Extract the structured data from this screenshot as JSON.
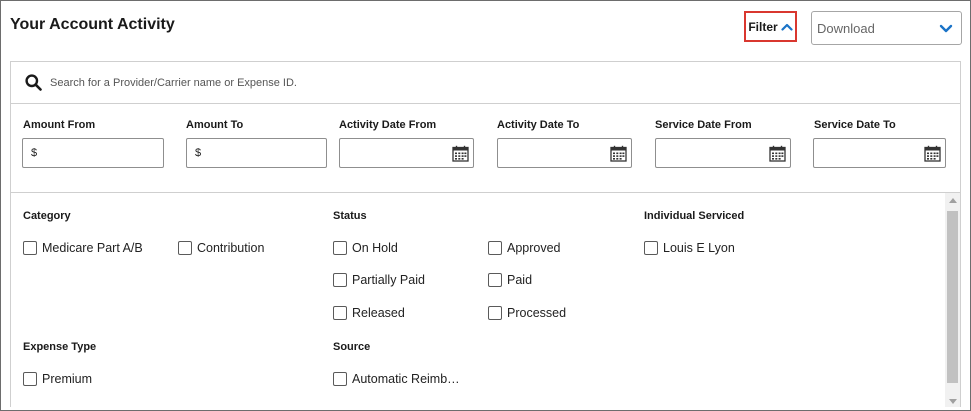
{
  "header": {
    "title": "Your Account Activity",
    "filter_label": "Filter",
    "download_label": "Download"
  },
  "search": {
    "placeholder": "Search for a Provider/Carrier name or Expense ID.",
    "value": ""
  },
  "fields": [
    {
      "label": "Amount From",
      "prefix": "$",
      "icon": ""
    },
    {
      "label": "Amount To",
      "prefix": "$",
      "icon": ""
    },
    {
      "label": "Activity Date From",
      "prefix": "",
      "icon": "calendar-icon"
    },
    {
      "label": "Activity Date To",
      "prefix": "",
      "icon": "calendar-icon"
    },
    {
      "label": "Service Date From",
      "prefix": "",
      "icon": "calendar-icon"
    },
    {
      "label": "Service Date To",
      "prefix": "",
      "icon": "calendar-icon"
    }
  ],
  "groups": {
    "category": {
      "label": "Category",
      "options": [
        "Medicare Part A/B",
        "Contribution"
      ]
    },
    "status": {
      "label": "Status",
      "options": [
        "On Hold",
        "Approved",
        "Partially Paid",
        "Paid",
        "Released",
        "Processed"
      ]
    },
    "individual": {
      "label": "Individual Serviced",
      "options": [
        "Louis E Lyon"
      ]
    },
    "expense_type": {
      "label": "Expense Type",
      "options": [
        "Premium"
      ]
    },
    "source": {
      "label": "Source",
      "options": [
        "Automatic Reimb…"
      ]
    }
  },
  "colors": {
    "accent": "#1a73c7",
    "filter_outline": "#d9372f",
    "border": "#cfcfcf"
  },
  "icons": {
    "search": "search-icon",
    "filter_toggle": "chevron-up-icon",
    "download_toggle": "chevron-down-icon",
    "date": "calendar-icon"
  }
}
